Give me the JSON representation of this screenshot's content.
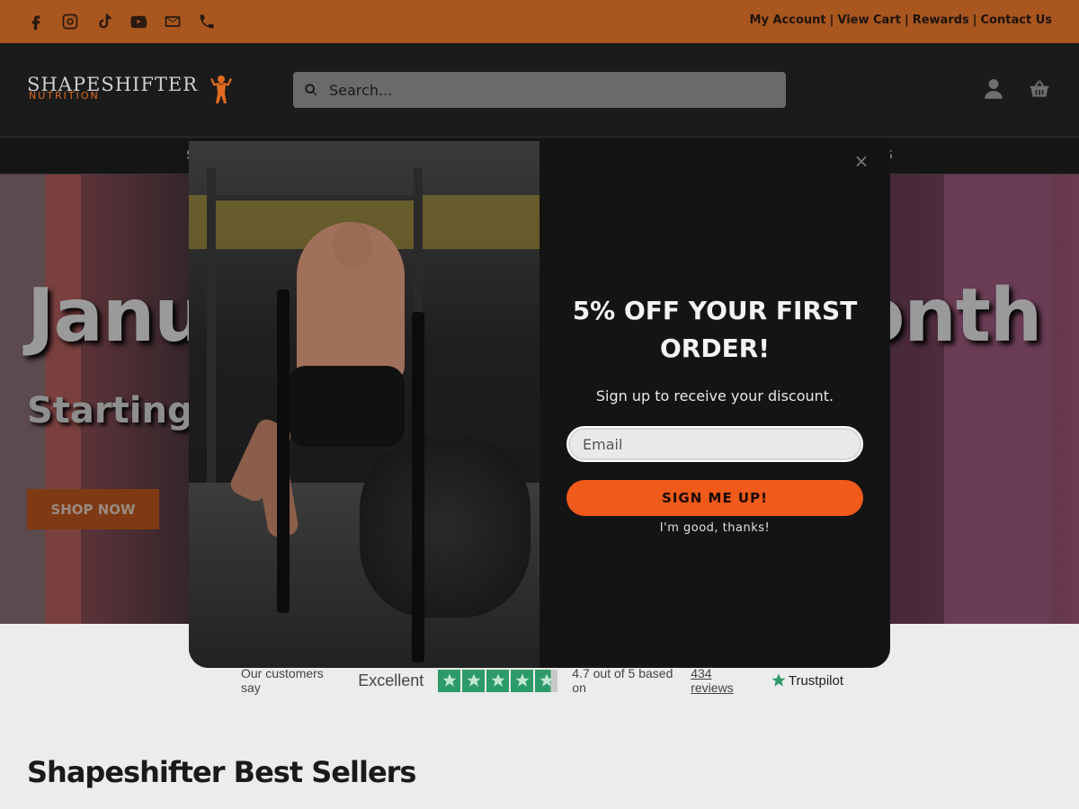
{
  "topbar": {
    "social_icons": [
      "facebook-icon",
      "instagram-icon",
      "tiktok-icon",
      "youtube-icon",
      "envelope-icon",
      "phone-icon"
    ],
    "links": [
      "My Account",
      "View Cart",
      "Rewards",
      "Contact Us"
    ],
    "separator": "|",
    "background": "#a9561f"
  },
  "header": {
    "logo_line1": "SHAPESHIFTER",
    "logo_line2": "NUTRITION",
    "search_placeholder": "Search...",
    "icons": [
      "user-icon",
      "basket-icon"
    ]
  },
  "nav": {
    "left_fragment": "S",
    "right_fragment": "S"
  },
  "hero": {
    "title_start": "Janu",
    "title_end": "onth",
    "subtitle": "Starting c",
    "cta": "SHOP NOW"
  },
  "trustpilot": {
    "prefix": "Our customers say",
    "verdict": "Excellent",
    "rating_text": "4.7 out of 5 based on",
    "reviews_link": "434 reviews",
    "brand": "Trustpilot",
    "stars": 4.7
  },
  "bestsellers": {
    "heading": "Shapeshifter Best Sellers"
  },
  "popup": {
    "close_label": "×",
    "heading": "5% OFF YOUR FIRST ORDER!",
    "subheading": "Sign up to receive your discount.",
    "email_placeholder": "Email",
    "submit_label": "SIGN ME UP!",
    "decline_label": "I'm good, thanks!",
    "accent_color": "#f05a1a"
  }
}
